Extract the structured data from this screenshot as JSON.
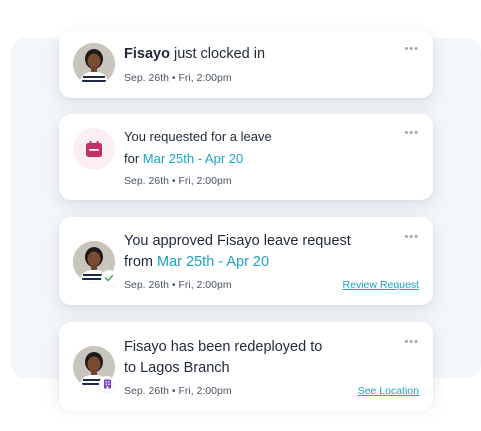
{
  "notifications": [
    {
      "name": "Fisayo",
      "text": "just clocked in",
      "meta": "Sep. 26th • Fri, 2:00pm",
      "more": "•••"
    },
    {
      "line1": "You requested for a leave",
      "prefix": "for",
      "dates": "Mar 25th - Apr 20",
      "meta": "Sep. 26th • Fri, 2:00pm",
      "more": "•••",
      "icon": "calendar-icon"
    },
    {
      "line1": "You approved Fisayo leave request",
      "prefix": "from",
      "dates": "Mar 25th - Apr 20",
      "meta": "Sep. 26th • Fri, 2:00pm",
      "link": "Review Request",
      "more": "•••",
      "badge_icon": "check-icon"
    },
    {
      "line1": "Fisayo has been redeployed to",
      "line2": "to Lagos Branch",
      "meta": "Sep. 26th • Fri, 2:00pm",
      "link": "See Location",
      "more": "•••",
      "badge_icon": "building-icon"
    }
  ],
  "colors": {
    "accent": "#1aa3c6",
    "calendar": "#c2306a",
    "check": "#3fb56b",
    "building": "#7b3fd0"
  }
}
